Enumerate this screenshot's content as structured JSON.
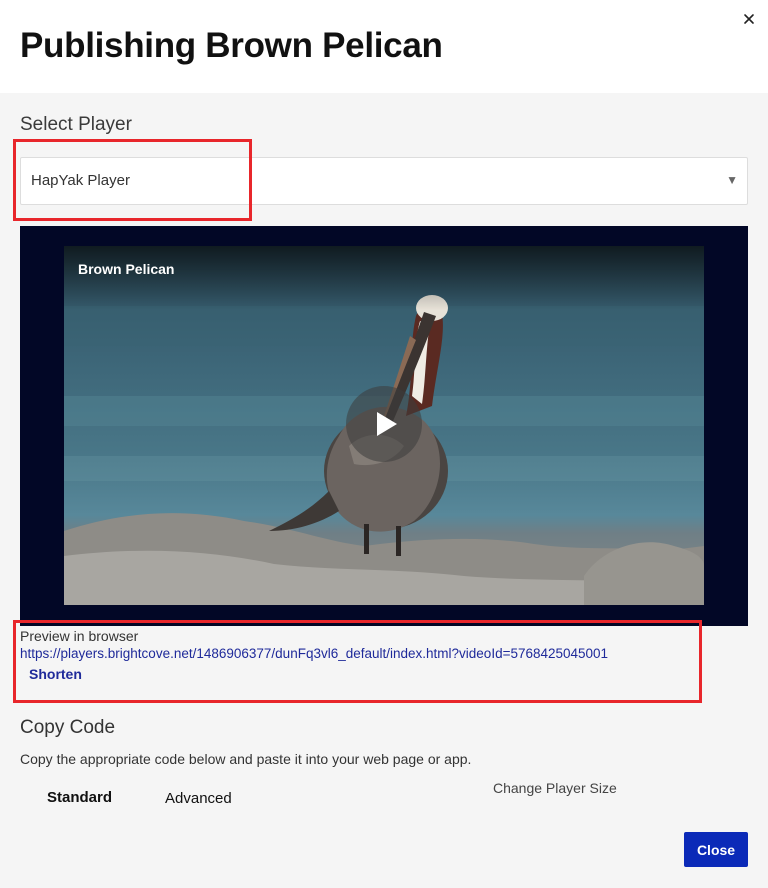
{
  "modal": {
    "title": "Publishing Brown Pelican",
    "close_icon": "close-icon"
  },
  "player_select": {
    "label": "Select Player",
    "selected": "HapYak Player",
    "caret_icon": "caret-down-icon"
  },
  "video": {
    "title": "Brown Pelican",
    "play_icon": "play-icon"
  },
  "preview": {
    "label": "Preview in browser",
    "url": "https://players.brightcove.net/1486906377/dunFq3vl6_default/index.html?videoId=5768425045001",
    "shorten_label": "Shorten"
  },
  "copy_code": {
    "heading": "Copy Code",
    "description": "Copy the appropriate code below and paste it into your web page or app.",
    "tabs": [
      {
        "label": "Standard",
        "active": true
      },
      {
        "label": "Advanced",
        "active": false
      }
    ],
    "change_size_label": "Change Player Size"
  },
  "footer": {
    "close_label": "Close"
  },
  "colors": {
    "accent": "#0b2ab8",
    "link": "#1f2a9a",
    "highlight": "#e8262b",
    "player_bg": "#020726"
  }
}
